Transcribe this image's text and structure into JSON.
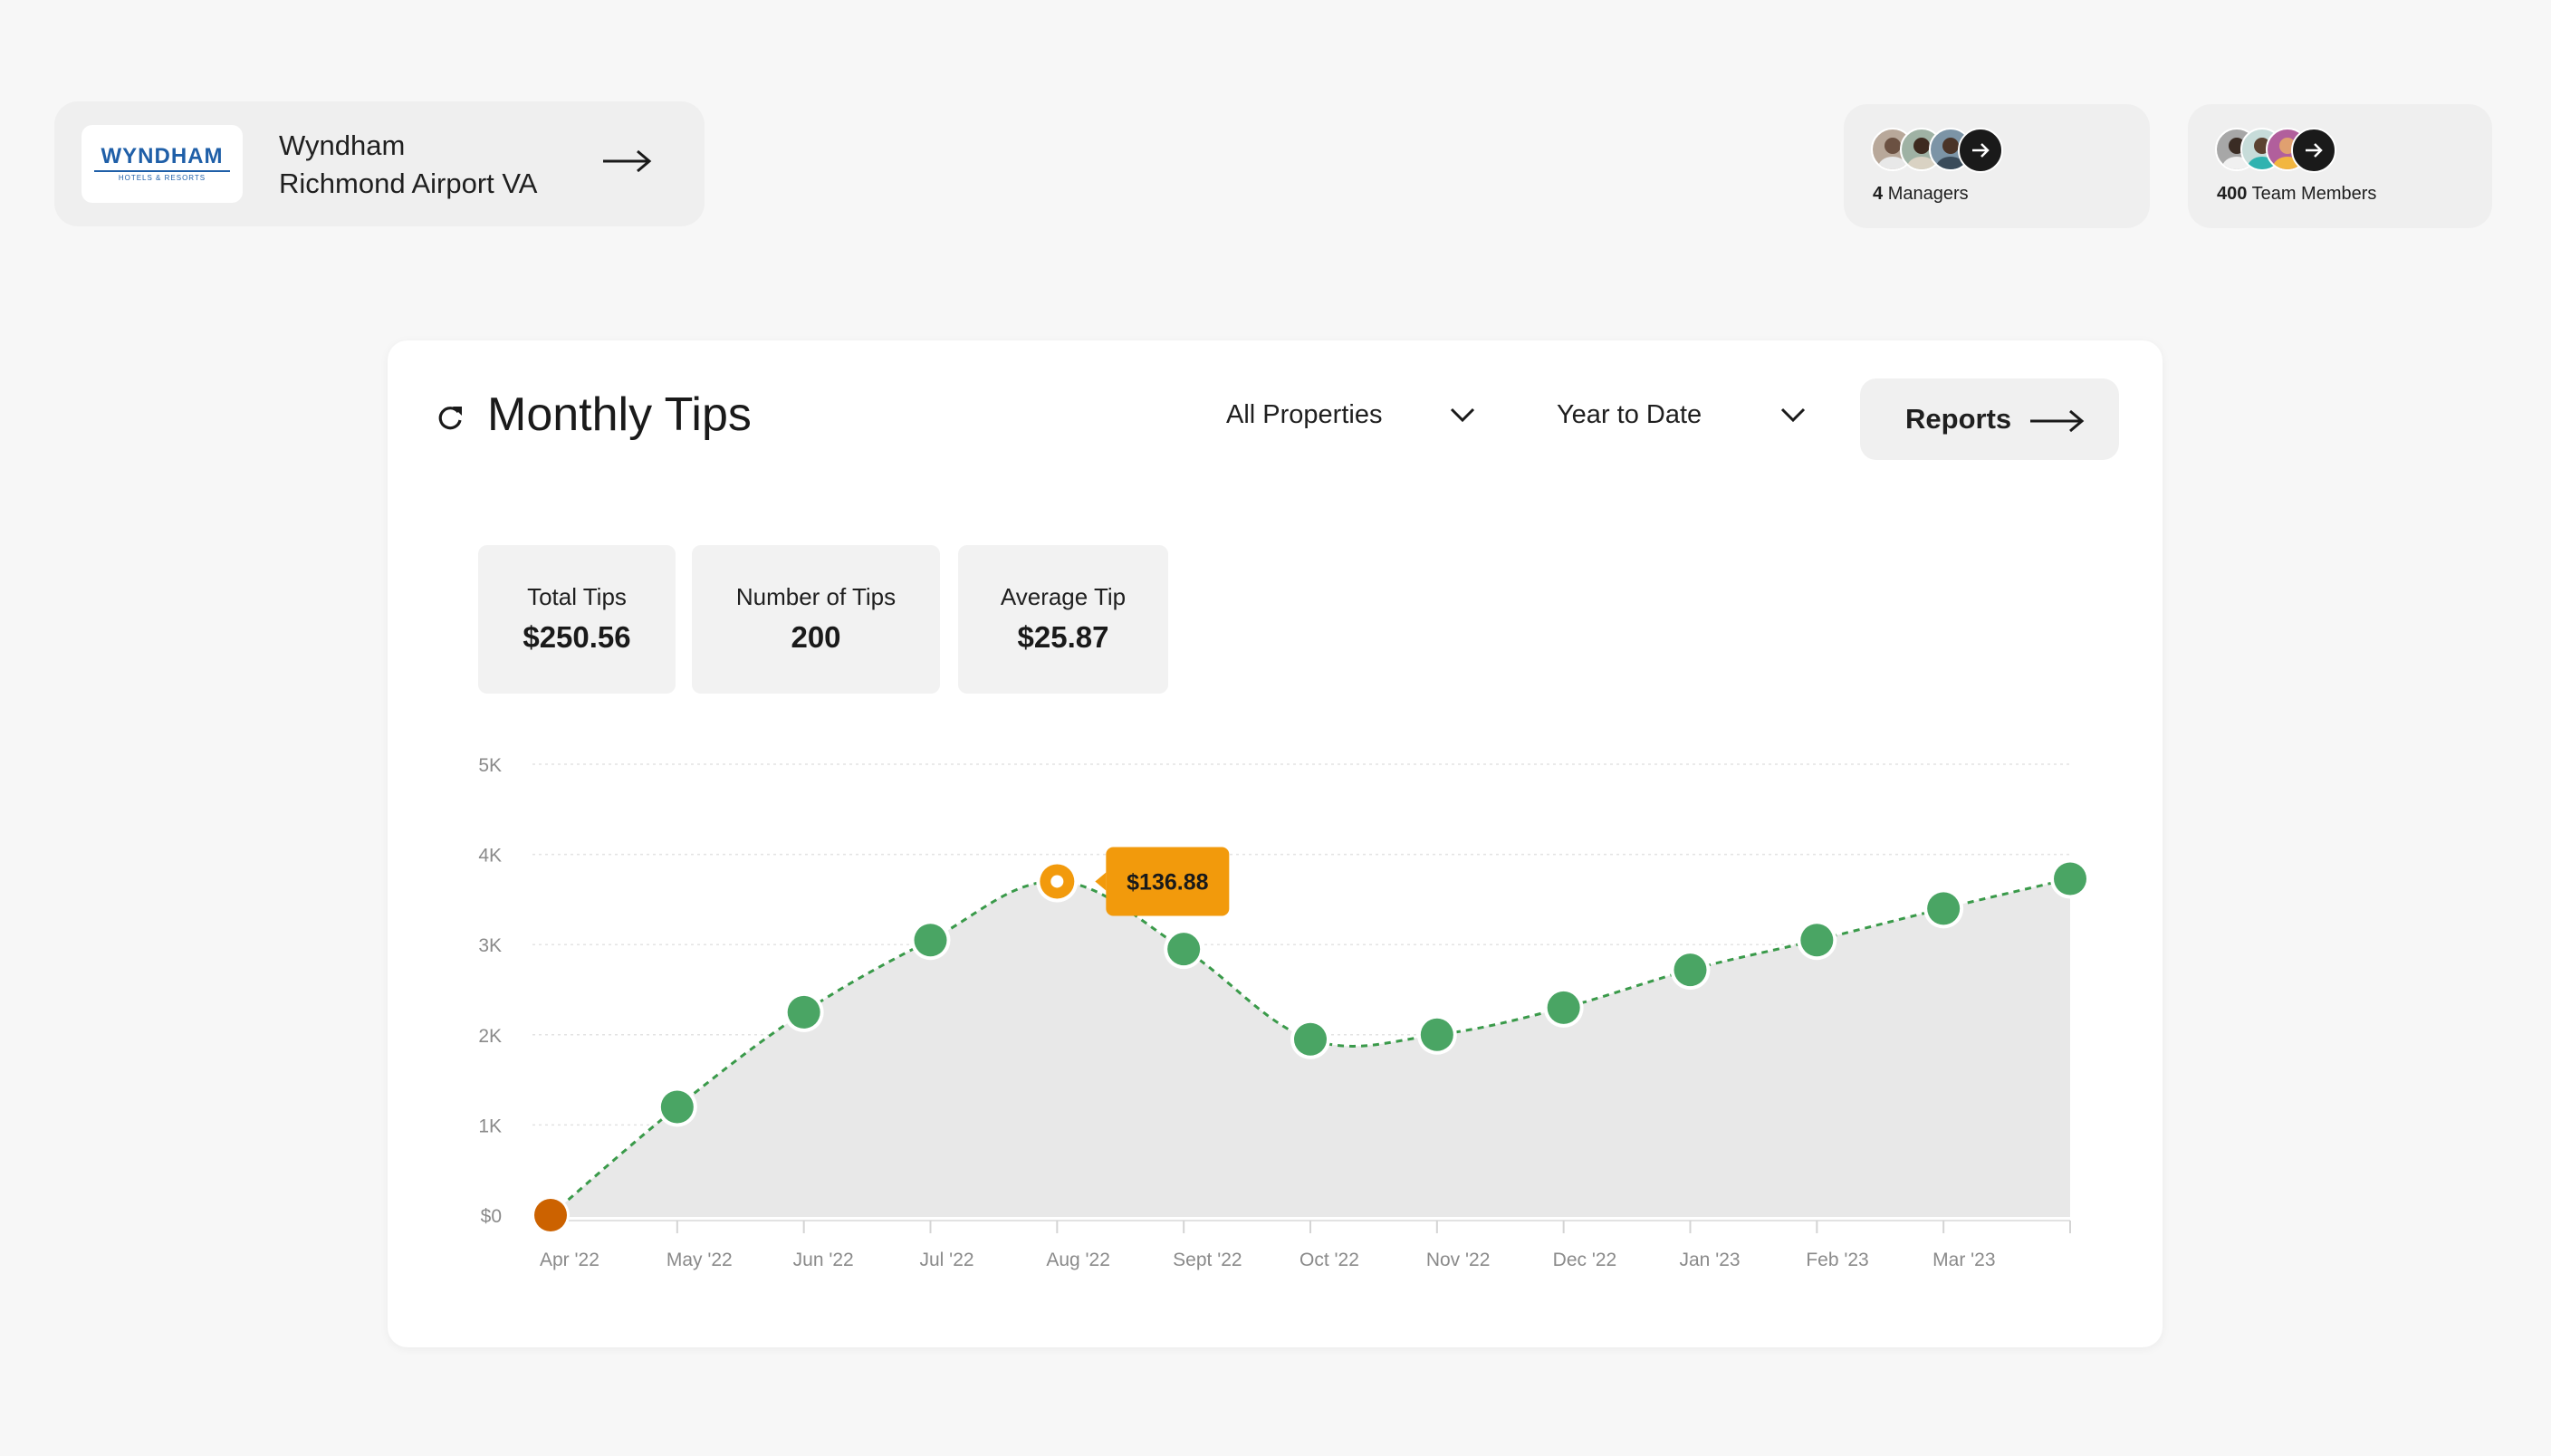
{
  "property": {
    "logo_word": "WYNDHAM",
    "logo_sub": "HOTELS & RESORTS",
    "name_line1": "Wyndham",
    "name_line2": "Richmond Airport VA"
  },
  "managers": {
    "count": "4",
    "label": "Managers"
  },
  "team": {
    "count": "400",
    "label": "Team Members"
  },
  "header": {
    "title": "Monthly Tips",
    "property_filter": "All Properties",
    "period_filter": "Year to Date",
    "reports_label": "Reports"
  },
  "stats": [
    {
      "label": "Total Tips",
      "value": "$250.56"
    },
    {
      "label": "Number of Tips",
      "value": "200"
    },
    {
      "label": "Average Tip",
      "value": "$25.87"
    }
  ],
  "colors": {
    "point": "#4aa564",
    "line": "#3a9a4a",
    "highlight": "#f29a0c",
    "start_point": "#cc6200",
    "area": "#e8e8e8",
    "tooltip": "#f29a0c"
  },
  "chart_data": {
    "type": "area",
    "categories": [
      "Apr '22",
      "May '22",
      "Jun '22",
      "Jul '22",
      "Aug '22",
      "Sept '22",
      "Oct '22",
      "Nov '22",
      "Dec '22",
      "Jan '23",
      "Feb '23",
      "Mar '23"
    ],
    "values": [
      0,
      1200,
      2250,
      3050,
      3700,
      2950,
      1950,
      2000,
      2300,
      2720,
      3050,
      3400,
      3730
    ],
    "y_tick_labels": [
      "$0",
      "1K",
      "2K",
      "3K",
      "4K",
      "5K"
    ],
    "ylim": [
      0,
      5000
    ],
    "highlight_index": 4,
    "tooltip": "$136.88",
    "grid": true,
    "line_style": "dashed"
  }
}
